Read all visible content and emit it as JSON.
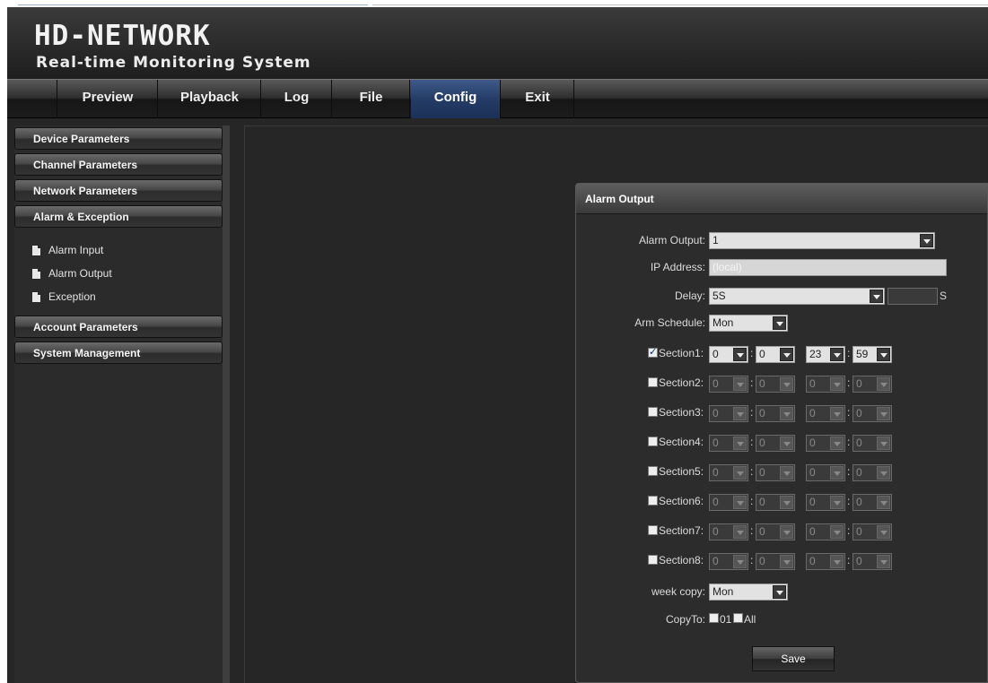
{
  "header": {
    "logo": "HD-NETWORK",
    "tagline": "Real-time Monitoring System"
  },
  "nav": {
    "tabs": [
      "Preview",
      "Playback",
      "Log",
      "File",
      "Config",
      "Exit"
    ],
    "active": "Config"
  },
  "sidebar": {
    "groups": [
      {
        "label": "Device Parameters"
      },
      {
        "label": "Channel Parameters"
      },
      {
        "label": "Network Parameters"
      },
      {
        "label": "Alarm & Exception"
      },
      {
        "label": "Account Parameters"
      },
      {
        "label": "System Management"
      }
    ],
    "alarm_items": [
      "Alarm Input",
      "Alarm Output",
      "Exception"
    ]
  },
  "panel": {
    "title": "Alarm Output",
    "alarm_output_label": "Alarm Output:",
    "alarm_output_value": "1",
    "ip_label": "IP Address:",
    "ip_value": "(local)",
    "delay_label": "Delay:",
    "delay_value": "5S",
    "delay_unit": "S",
    "arm_label": "Arm Schedule:",
    "arm_value": "Mon",
    "sections": [
      {
        "label": "Section1:",
        "checked": true,
        "values": [
          "0",
          "0",
          "23",
          "59"
        ]
      },
      {
        "label": "Section2:",
        "checked": false,
        "values": [
          "0",
          "0",
          "0",
          "0"
        ]
      },
      {
        "label": "Section3:",
        "checked": false,
        "values": [
          "0",
          "0",
          "0",
          "0"
        ]
      },
      {
        "label": "Section4:",
        "checked": false,
        "values": [
          "0",
          "0",
          "0",
          "0"
        ]
      },
      {
        "label": "Section5:",
        "checked": false,
        "values": [
          "0",
          "0",
          "0",
          "0"
        ]
      },
      {
        "label": "Section6:",
        "checked": false,
        "values": [
          "0",
          "0",
          "0",
          "0"
        ]
      },
      {
        "label": "Section7:",
        "checked": false,
        "values": [
          "0",
          "0",
          "0",
          "0"
        ]
      },
      {
        "label": "Section8:",
        "checked": false,
        "values": [
          "0",
          "0",
          "0",
          "0"
        ]
      }
    ],
    "week_copy_label": "week copy:",
    "week_copy_value": "Mon",
    "copyto_label": "CopyTo:",
    "copyto_options": [
      "01",
      "All"
    ],
    "save_label": "Save"
  }
}
